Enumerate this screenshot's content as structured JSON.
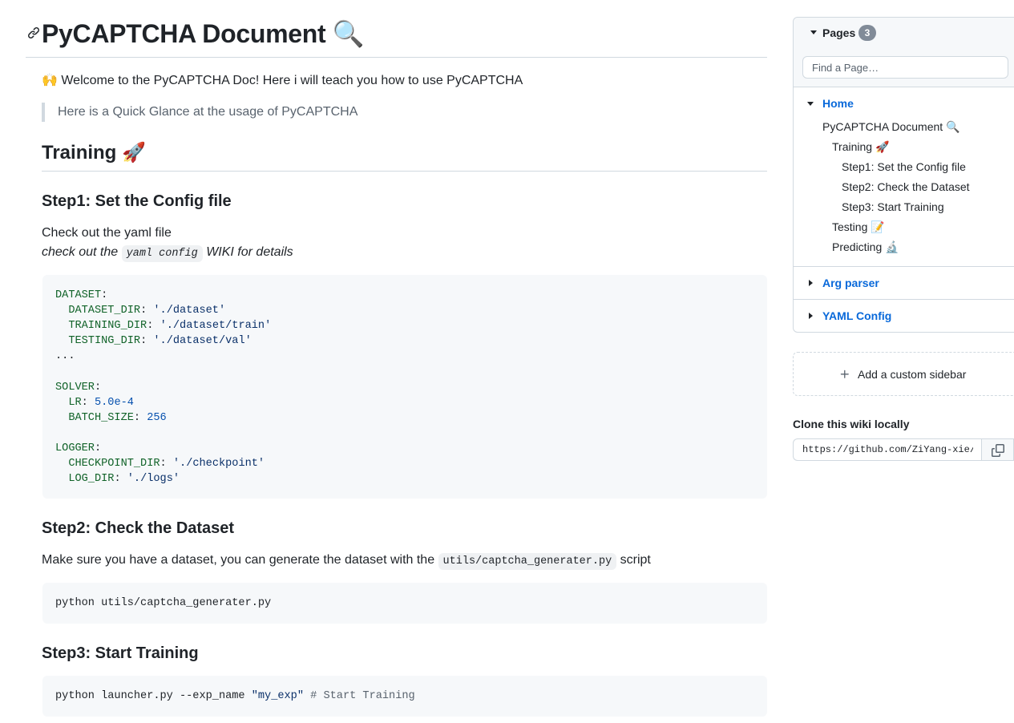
{
  "article": {
    "title": "PyCAPTCHA Document 🔍",
    "welcome": "🙌 Welcome to the PyCAPTCHA Doc! Here i will teach you how to use PyCAPTCHA",
    "quote": "Here is a Quick Glance at the usage of PyCAPTCHA",
    "training_heading": "Training 🚀",
    "step1": {
      "heading": "Step1: Set the Config file",
      "line1": "Check out the yaml file",
      "line2_pre": "check out the ",
      "line2_code": "yaml config",
      "line2_post": " WIKI for details"
    },
    "config_code": [
      {
        "k": "DATASET",
        "sep": ":",
        "v": "",
        "vt": "",
        "indent": ""
      },
      {
        "k": "DATASET_DIR",
        "sep": ": ",
        "v": "'./dataset'",
        "vt": "str",
        "indent": "  "
      },
      {
        "k": "TRAINING_DIR",
        "sep": ": ",
        "v": "'./dataset/train'",
        "vt": "str",
        "indent": "  "
      },
      {
        "k": "TESTING_DIR",
        "sep": ": ",
        "v": "'./dataset/val'",
        "vt": "str",
        "indent": "  "
      },
      {
        "k": "",
        "sep": "...",
        "v": "",
        "vt": "",
        "indent": ""
      },
      {
        "k": "",
        "sep": "",
        "v": "",
        "vt": "",
        "indent": ""
      },
      {
        "k": "SOLVER",
        "sep": ":",
        "v": "",
        "vt": "",
        "indent": ""
      },
      {
        "k": "LR",
        "sep": ": ",
        "v": "5.0e-4",
        "vt": "num",
        "indent": "  "
      },
      {
        "k": "BATCH_SIZE",
        "sep": ": ",
        "v": "256",
        "vt": "num",
        "indent": "  "
      },
      {
        "k": "",
        "sep": "",
        "v": "",
        "vt": "",
        "indent": ""
      },
      {
        "k": "LOGGER",
        "sep": ":",
        "v": "",
        "vt": "",
        "indent": ""
      },
      {
        "k": "CHECKPOINT_DIR",
        "sep": ": ",
        "v": "'./checkpoint'",
        "vt": "str",
        "indent": "  "
      },
      {
        "k": "LOG_DIR",
        "sep": ": ",
        "v": "'./logs'",
        "vt": "str",
        "indent": "  "
      }
    ],
    "step2": {
      "heading": "Step2: Check the Dataset",
      "text_pre": "Make sure you have a dataset, you can generate the dataset with the ",
      "text_code": "utils/captcha_generater.py",
      "text_post": " script",
      "command": "python utils/captcha_generater.py"
    },
    "step3": {
      "heading": "Step3: Start Training",
      "cmd_pre": "python launcher.py --exp_name ",
      "cmd_str": "\"my_exp\"",
      "cmd_comment": " # Start Training"
    }
  },
  "sidebar": {
    "pages_label": "Pages",
    "pages_count": "3",
    "find_placeholder": "Find a Page…",
    "home_label": "Home",
    "home_items": [
      {
        "label": "PyCAPTCHA Document 🔍"
      },
      {
        "label": "Training 🚀"
      },
      {
        "label": "Step1: Set the Config file"
      },
      {
        "label": "Step2: Check the Dataset"
      },
      {
        "label": "Step3: Start Training"
      },
      {
        "label": "Testing 📝"
      },
      {
        "label": "Predicting 🔬"
      }
    ],
    "arg_parser_label": "Arg parser",
    "yaml_config_label": "YAML Config",
    "add_sidebar_label": "Add a custom sidebar",
    "clone_title": "Clone this wiki locally",
    "clone_url": "https://github.com/ZiYang-xie/PyCAPTCHA.wiki.git"
  },
  "colors": {
    "link": "#0969da",
    "border": "#d1d9e0",
    "code_bg": "#f6f8fa"
  }
}
